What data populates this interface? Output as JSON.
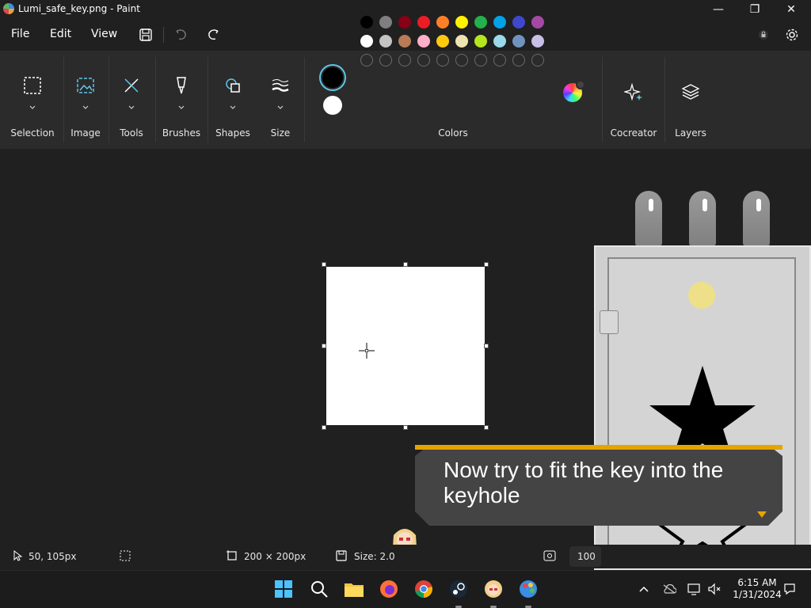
{
  "window": {
    "title": "Lumi_safe_key.png - Paint",
    "minimize_glyph": "—",
    "maximize_glyph": "❐",
    "close_glyph": "✕"
  },
  "menu": {
    "file": "File",
    "edit": "Edit",
    "view": "View"
  },
  "ribbon": {
    "groups": [
      {
        "name": "selection",
        "label": "Selection",
        "icon": "selection-icon"
      },
      {
        "name": "image",
        "label": "Image",
        "icon": "image-icon"
      },
      {
        "name": "tools",
        "label": "Tools",
        "icon": "tools-icon"
      },
      {
        "name": "brushes",
        "label": "Brushes",
        "icon": "brush-icon"
      },
      {
        "name": "shapes",
        "label": "Shapes",
        "icon": "shapes-icon"
      },
      {
        "name": "size",
        "label": "Size",
        "icon": "size-icon"
      }
    ],
    "colors_label": "Colors",
    "cocreator_label": "Cocreator",
    "layers_label": "Layers",
    "palette_row1": [
      "#000000",
      "#7f7f7f",
      "#880015",
      "#ed1c24",
      "#ff7f27",
      "#fff200",
      "#22b14c",
      "#00a2e8",
      "#3f48cc",
      "#a349a4"
    ],
    "palette_row2": [
      "#ffffff",
      "#c3c3c3",
      "#b97a57",
      "#ffaec9",
      "#ffc90e",
      "#efe4b0",
      "#b5e61d",
      "#99d9ea",
      "#7092be",
      "#c8bfe7"
    ],
    "primary_color": "#000000",
    "secondary_color": "#ffffff"
  },
  "dialog": {
    "text": "Now try to fit the key into the keyhole"
  },
  "status": {
    "cursor_pos": "50, 105px",
    "canvas_size": "200 × 200px",
    "file_size": "Size: 2.0",
    "zoom": "100"
  },
  "taskbar": {
    "apps": [
      "windows-start-icon",
      "search-icon",
      "file-explorer-icon",
      "firefox-icon",
      "chrome-icon",
      "steam-icon",
      "lumi-game-icon",
      "paint-icon"
    ],
    "time": "6:15 AM",
    "date": "1/31/2024"
  }
}
